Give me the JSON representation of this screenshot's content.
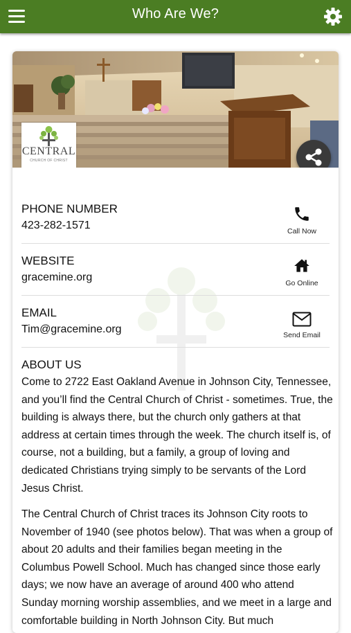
{
  "header": {
    "title": "Who Are We?"
  },
  "logo": {
    "name": "CENTRAL",
    "tagline": "CHURCH OF CHRIST"
  },
  "contact": {
    "phone": {
      "label": "PHONE NUMBER",
      "value": "423-282-1571",
      "action": "Call Now"
    },
    "website": {
      "label": "WEBSITE",
      "value": "gracemine.org",
      "action": "Go Online"
    },
    "email": {
      "label": "EMAIL",
      "value": "Tim@gracemine.org",
      "action": "Send Email"
    }
  },
  "about": {
    "title": "ABOUT US",
    "p1": "Come to 2722 East Oakland Avenue in Johnson City, Tennessee, and you’ll find the Central Church of Christ - sometimes. True, the building is always there, but the church only gathers at that address at certain times through the week. The church itself is, of course, not a building, but a family, a group of loving and dedicated Christians trying simply to be servants of the Lord Jesus Christ.",
    "p2": "The Central Church of Christ traces its Johnson City roots to November of 1940 (see photos below). That was when a group of about 20 adults and their families began meeting in the Columbus Powell School. Much has changed since those early days; we now have an average of around 400 who attend Sunday morning worship assemblies, and we meet in a large and comfortable building in North Johnson City. But much"
  },
  "colors": {
    "header": "#4b7d23",
    "share_button": "#3a3a3a"
  }
}
